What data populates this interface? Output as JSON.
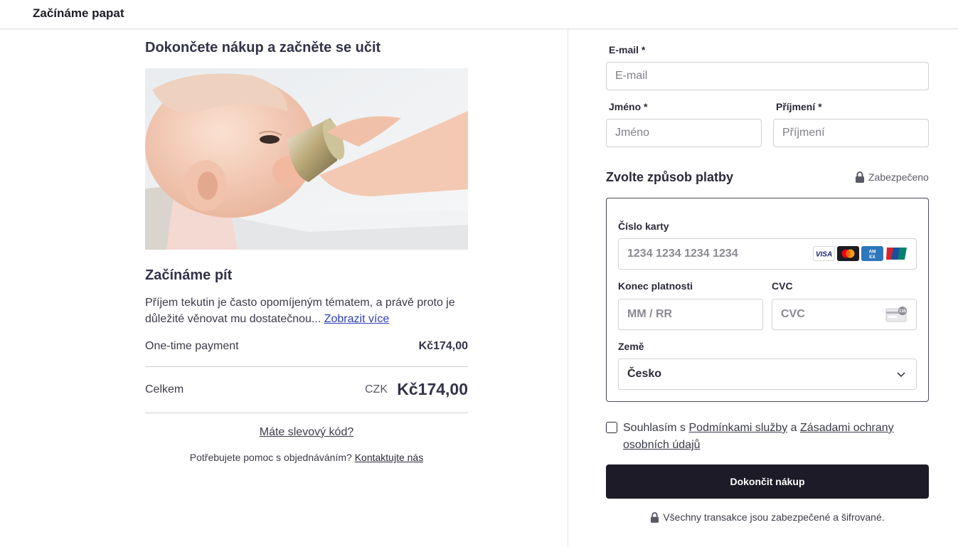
{
  "header": {
    "brand": "Začínáme papat"
  },
  "left": {
    "title": "Dokončete nákup a začněte se učit",
    "course_title": "Začínáme pít",
    "description": "Příjem tekutin je často opomíjeným tématem, a právě proto je důležité věnovat mu dostatečnou...",
    "show_more": "Zobrazit více",
    "payment_label": "One-time payment",
    "payment_amount": "Kč174,00",
    "total_label": "Celkem",
    "total_currency": "CZK",
    "total_amount": "Kč174,00",
    "discount_link": "Máte slevový kód?",
    "help_text": "Potřebujete pomoc s objednáváním?",
    "help_link": "Kontaktujte nás"
  },
  "form": {
    "email_label": "E-mail *",
    "email_placeholder": "E-mail",
    "first_name_label": "Jméno *",
    "first_name_placeholder": "Jméno",
    "last_name_label": "Příjmení *",
    "last_name_placeholder": "Příjmení",
    "payment_title": "Zvolte způsob platby",
    "secure_label": "Zabezpečeno",
    "card_number_label": "Číslo karty",
    "card_number_placeholder": "1234 1234 1234 1234",
    "expiry_label": "Konec platnosti",
    "expiry_placeholder": "MM / RR",
    "cvc_label": "CVC",
    "cvc_placeholder": "CVC",
    "country_label": "Země",
    "country_value": "Česko",
    "card_brands": [
      "VISA",
      "Mastercard",
      "AMEX",
      "UnionPay"
    ],
    "cvc_badge": "135",
    "consent_prefix": "Souhlasím s",
    "consent_terms": "Podmínkami služby",
    "consent_and": "a",
    "consent_privacy": "Zásadami ochrany osobních údajů",
    "submit_label": "Dokončit nákup",
    "footer_secure": "Všechny transakce jsou zabezpečené a šifrované."
  },
  "colors": {
    "button_bg": "#1c1b27",
    "link": "#2f3fb5",
    "text": "#3b3b4a"
  }
}
